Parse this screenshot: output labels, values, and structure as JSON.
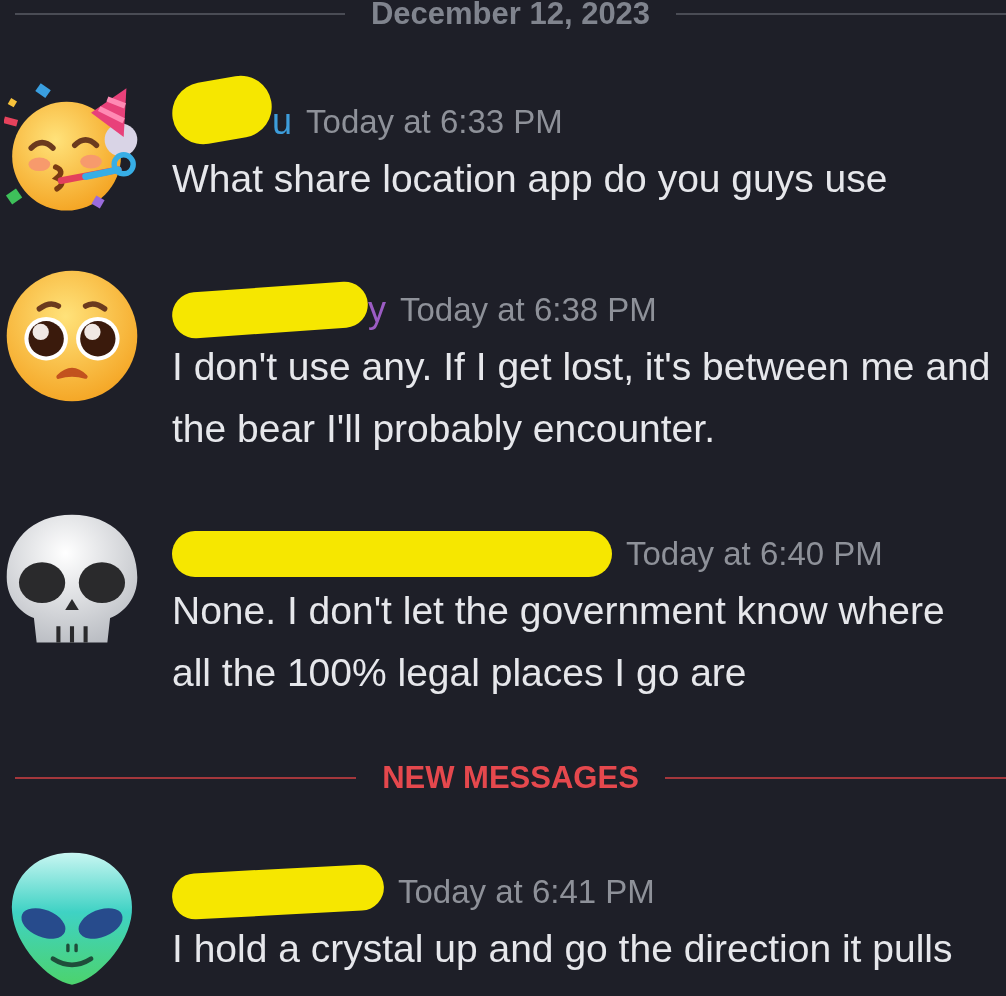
{
  "feed": [
    {
      "kind": "date_divider",
      "text": "December 12, 2023"
    },
    {
      "kind": "message",
      "avatar": {
        "kind": "party"
      },
      "author": {
        "redacted": true,
        "visible_text": "u",
        "color": "#3d9ddb"
      },
      "timestamp": "Today at 6:33 PM",
      "text": "What share location app do you guys use"
    },
    {
      "kind": "message",
      "avatar": {
        "kind": "pleading"
      },
      "author": {
        "redacted": true,
        "visible_text": "y",
        "color": "#9b5cc4"
      },
      "timestamp": "Today at 6:38 PM",
      "text": "I don't use any. If I get lost, it's between me and the bear I'll probably encounter."
    },
    {
      "kind": "message",
      "avatar": {
        "kind": "skull"
      },
      "author": {
        "redacted": true
      },
      "timestamp": "Today at 6:40 PM",
      "text": "None. I don't let the government know where all the 100% legal places I go are"
    },
    {
      "kind": "new_divider",
      "text": "NEW MESSAGES"
    },
    {
      "kind": "message",
      "avatar": {
        "kind": "alien"
      },
      "author": {
        "redacted": true
      },
      "timestamp": "Today at 6:41 PM",
      "text": "I hold a crystal up and go the direction it pulls"
    }
  ]
}
